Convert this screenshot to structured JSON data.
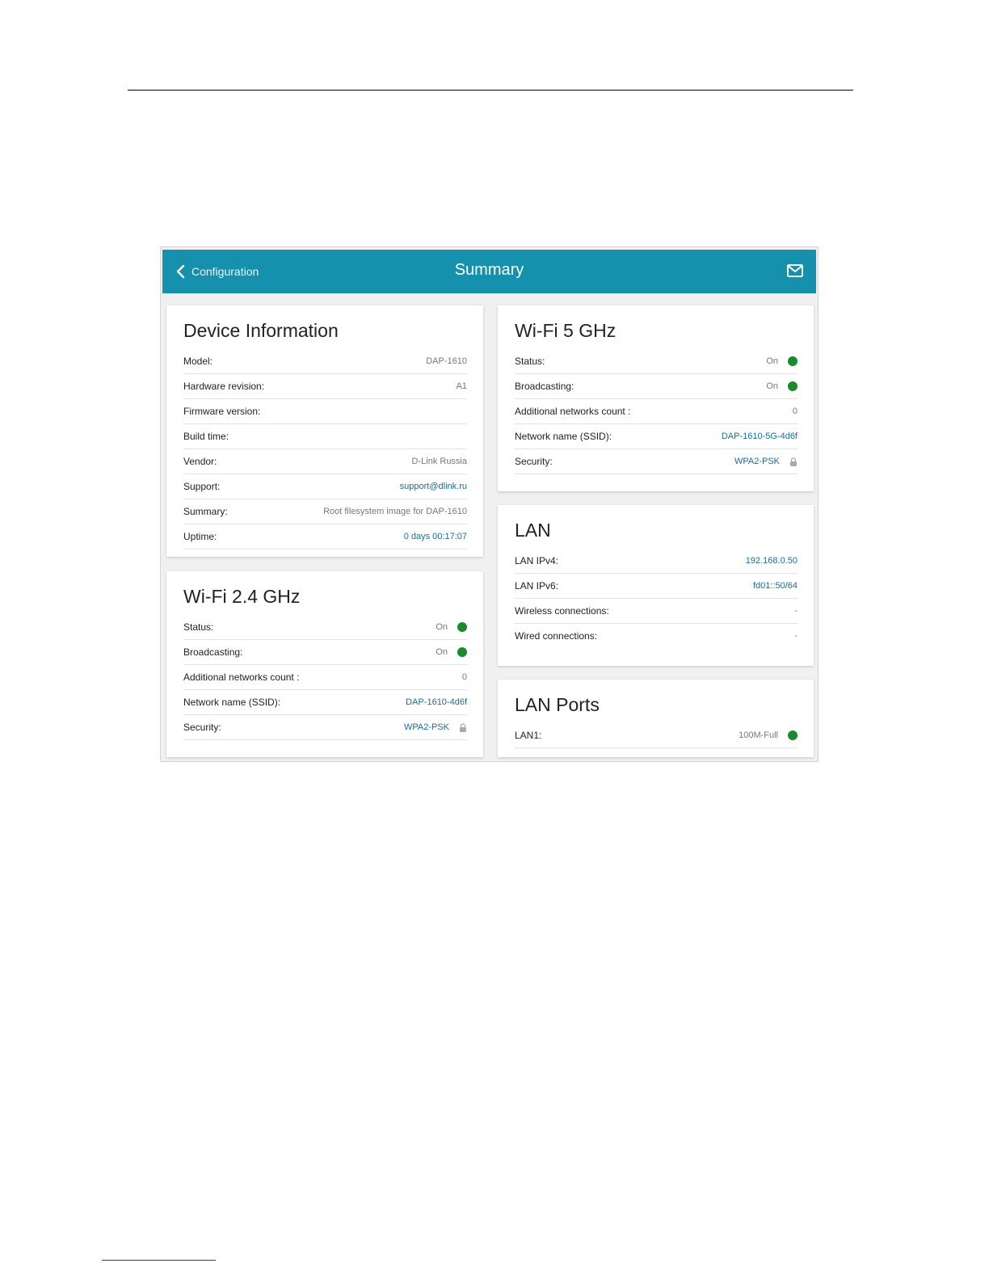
{
  "header": {
    "back_label": "Configuration",
    "title": "Summary",
    "back_icon": "chevron-left-icon",
    "mail_icon": "mail-icon"
  },
  "device_info": {
    "title": "Device Information",
    "rows": [
      {
        "label": "Model:",
        "value": "DAP-1610"
      },
      {
        "label": "Hardware revision:",
        "value": "A1"
      },
      {
        "label": "Firmware version:",
        "value": ""
      },
      {
        "label": "Build time:",
        "value": ""
      },
      {
        "label": "Vendor:",
        "value": "D-Link Russia"
      },
      {
        "label": "Support:",
        "value": "support@dlink.ru"
      },
      {
        "label": "Summary:",
        "value": "Root filesystem image for DAP-1610"
      },
      {
        "label": "Uptime:",
        "value": "0 days 00:17:07"
      }
    ]
  },
  "wifi24": {
    "title": "Wi-Fi 2.4 GHz",
    "rows": [
      {
        "label": "Status:",
        "value": "On"
      },
      {
        "label": "Broadcasting:",
        "value": "On"
      },
      {
        "label": "Additional networks count :",
        "value": "0"
      },
      {
        "label": "Network name (SSID):",
        "value": "DAP-1610-4d6f"
      },
      {
        "label": "Security:",
        "value": "WPA2-PSK"
      }
    ]
  },
  "wifi5": {
    "title": "Wi-Fi 5 GHz",
    "rows": [
      {
        "label": "Status:",
        "value": "On"
      },
      {
        "label": "Broadcasting:",
        "value": "On"
      },
      {
        "label": "Additional networks count :",
        "value": "0"
      },
      {
        "label": "Network name (SSID):",
        "value": "DAP-1610-5G-4d6f"
      },
      {
        "label": "Security:",
        "value": "WPA2-PSK"
      }
    ]
  },
  "lan": {
    "title": "LAN",
    "rows": [
      {
        "label": "LAN IPv4:",
        "value": "192.168.0.50"
      },
      {
        "label": "LAN IPv6:",
        "value": "fd01::50/64"
      },
      {
        "label": "Wireless connections:",
        "value": "-"
      },
      {
        "label": "Wired connections:",
        "value": "-"
      }
    ]
  },
  "lan_ports": {
    "title": "LAN Ports",
    "rows": [
      {
        "label": "LAN1:",
        "value": "100M-Full"
      }
    ]
  },
  "colors": {
    "topbar": "#1590ad",
    "status_on": "#1a8a2a",
    "link": "#1a6ca0"
  }
}
